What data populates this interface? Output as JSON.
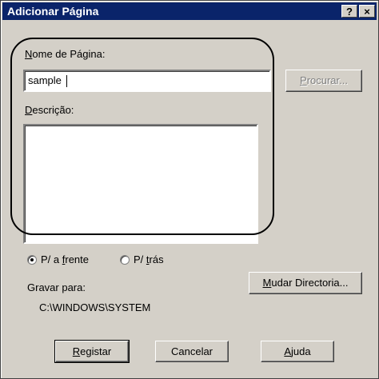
{
  "window": {
    "title": "Adicionar Página",
    "help_glyph": "?",
    "close_glyph": "×"
  },
  "form": {
    "name_label_accel": "N",
    "name_label_rest": "ome de Página:",
    "name_value": "sample",
    "browse_accel": "P",
    "browse_rest": "rocurar...",
    "desc_label_accel": "D",
    "desc_label_rest": "escrição:",
    "desc_value": ""
  },
  "orientation": {
    "front_pre": "P/ a ",
    "front_accel": "f",
    "front_post": "rente",
    "back_pre": "P/ ",
    "back_accel": "t",
    "back_post": "rás",
    "selected": "front"
  },
  "save": {
    "label": "Gravar para:",
    "path": "C:\\WINDOWS\\SYSTEM",
    "change_accel": "M",
    "change_rest": "udar Directoria..."
  },
  "footer": {
    "register_accel": "R",
    "register_rest": "egistar",
    "cancel": "Cancelar",
    "help_accel": "A",
    "help_rest": "juda"
  },
  "colors": {
    "titlebar": "#0a246a",
    "face": "#d4d0c8",
    "highlight_outline": "#000000"
  }
}
